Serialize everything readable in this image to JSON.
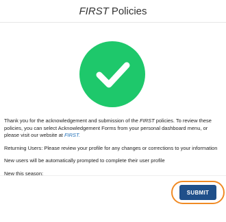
{
  "header": {
    "title_em": "FIRST",
    "title_rest": "Policies"
  },
  "icons": {
    "success": "checkmark-circle-icon",
    "success_color": "#1ec86b"
  },
  "content": {
    "p1_a": "Thank you for the acknowledgement and submission of the ",
    "p1_em": "FIRST",
    "p1_b": " policies. To review these policies, you can select Acknowledgement Forms from your personal dashboard menu, or please visit our website at ",
    "p1_link": "FIRST.",
    "p2": "Returning Users: Please review your profile for any changes or corrections to your information",
    "p3": "New users will be automatically prompted to complete their user profile",
    "p4": "New this season:"
  },
  "actions": {
    "submit_label": "SUBMIT",
    "button_color": "#1f4f8a",
    "highlight_color": "#f08a24"
  }
}
